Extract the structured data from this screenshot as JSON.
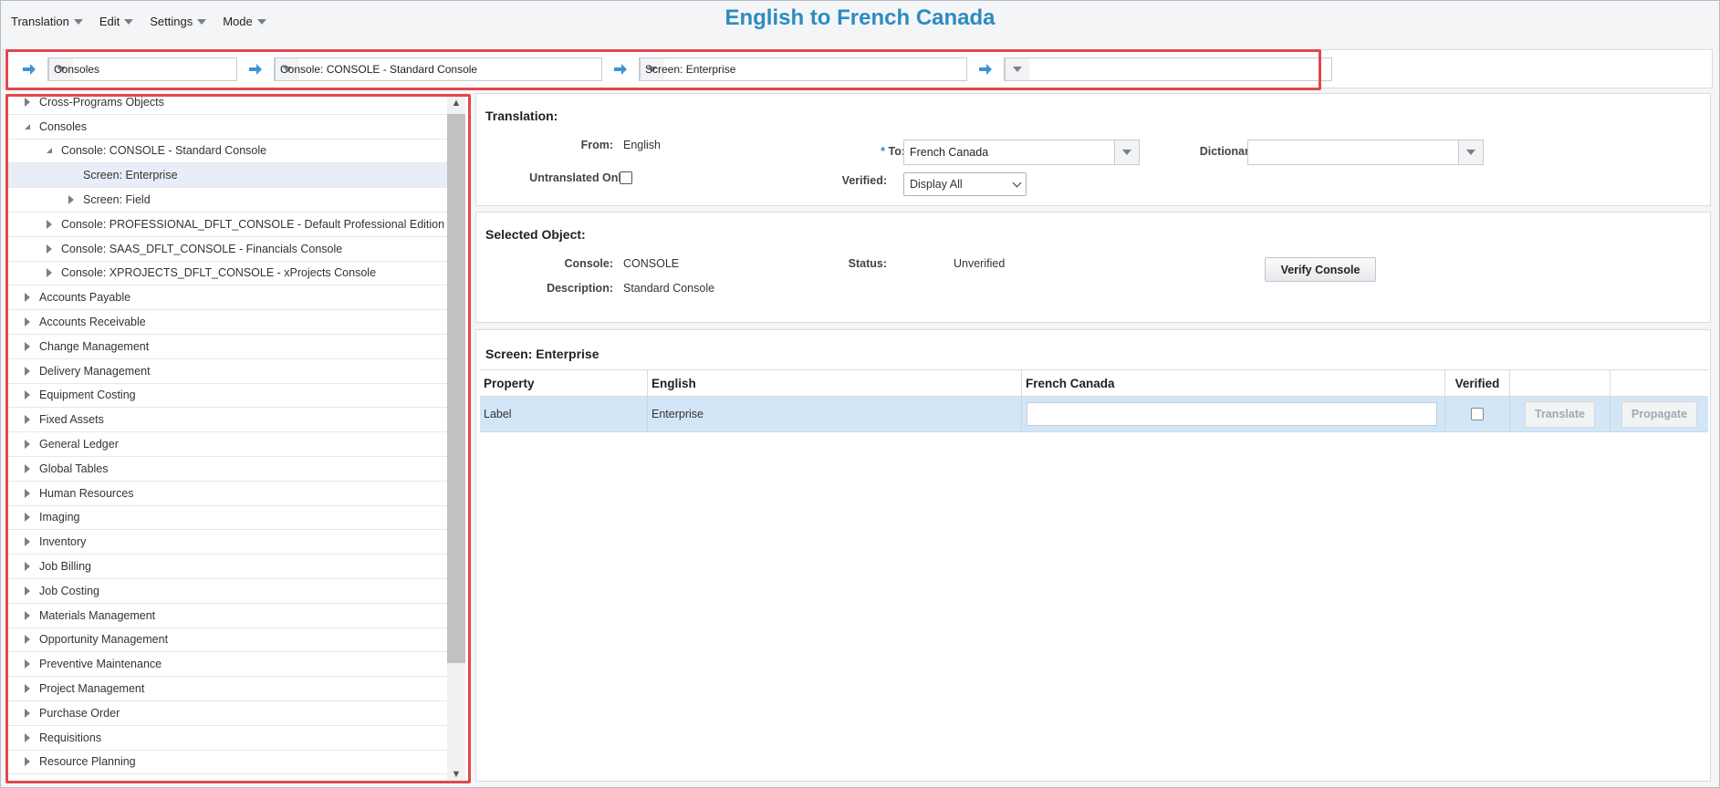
{
  "menu": {
    "items": [
      {
        "label": "Translation"
      },
      {
        "label": "Edit"
      },
      {
        "label": "Settings"
      },
      {
        "label": "Mode"
      }
    ]
  },
  "title": "English to French Canada",
  "breadcrumb": {
    "items": [
      {
        "value": "Consoles"
      },
      {
        "value": "Console: CONSOLE - Standard Console"
      },
      {
        "value": "Screen: Enterprise"
      },
      {
        "value": ""
      }
    ]
  },
  "tree": {
    "items": [
      {
        "label": "Cross-Programs Objects",
        "level": 0,
        "state": "collapsed"
      },
      {
        "label": "Consoles",
        "level": 0,
        "state": "expanded"
      },
      {
        "label": "Console: CONSOLE - Standard Console",
        "level": 1,
        "state": "expanded"
      },
      {
        "label": "Screen: Enterprise",
        "level": 2,
        "state": "leaf",
        "selected": true
      },
      {
        "label": "Screen: Field",
        "level": 2,
        "state": "collapsed"
      },
      {
        "label": "Console: PROFESSIONAL_DFLT_CONSOLE - Default Professional Edition Cc",
        "level": 1,
        "state": "collapsed"
      },
      {
        "label": "Console: SAAS_DFLT_CONSOLE - Financials Console",
        "level": 1,
        "state": "collapsed"
      },
      {
        "label": "Console: XPROJECTS_DFLT_CONSOLE - xProjects Console",
        "level": 1,
        "state": "collapsed"
      },
      {
        "label": "Accounts Payable",
        "level": 0,
        "state": "collapsed"
      },
      {
        "label": "Accounts Receivable",
        "level": 0,
        "state": "collapsed"
      },
      {
        "label": "Change Management",
        "level": 0,
        "state": "collapsed"
      },
      {
        "label": "Delivery Management",
        "level": 0,
        "state": "collapsed"
      },
      {
        "label": "Equipment Costing",
        "level": 0,
        "state": "collapsed"
      },
      {
        "label": "Fixed Assets",
        "level": 0,
        "state": "collapsed"
      },
      {
        "label": "General Ledger",
        "level": 0,
        "state": "collapsed"
      },
      {
        "label": "Global Tables",
        "level": 0,
        "state": "collapsed"
      },
      {
        "label": "Human Resources",
        "level": 0,
        "state": "collapsed"
      },
      {
        "label": "Imaging",
        "level": 0,
        "state": "collapsed"
      },
      {
        "label": "Inventory",
        "level": 0,
        "state": "collapsed"
      },
      {
        "label": "Job Billing",
        "level": 0,
        "state": "collapsed"
      },
      {
        "label": "Job Costing",
        "level": 0,
        "state": "collapsed"
      },
      {
        "label": "Materials Management",
        "level": 0,
        "state": "collapsed"
      },
      {
        "label": "Opportunity Management",
        "level": 0,
        "state": "collapsed"
      },
      {
        "label": "Preventive Maintenance",
        "level": 0,
        "state": "collapsed"
      },
      {
        "label": "Project Management",
        "level": 0,
        "state": "collapsed"
      },
      {
        "label": "Purchase Order",
        "level": 0,
        "state": "collapsed"
      },
      {
        "label": "Requisitions",
        "level": 0,
        "state": "collapsed"
      },
      {
        "label": "Resource Planning",
        "level": 0,
        "state": "collapsed"
      }
    ]
  },
  "translation": {
    "heading": "Translation:",
    "from_label": "From:",
    "from_value": "English",
    "to_required": "*",
    "to_label": "To:",
    "to_value": "French Canada",
    "dictionary_label": "Dictionary:",
    "dictionary_value": "",
    "untranslated_label": "Untranslated Only:",
    "verified_label": "Verified:",
    "verified_value": "Display All"
  },
  "selected_object": {
    "heading": "Selected Object:",
    "console_label": "Console:",
    "console_value": "CONSOLE",
    "status_label": "Status:",
    "status_value": "Unverified",
    "description_label": "Description:",
    "description_value": "Standard Console",
    "verify_button": "Verify Console"
  },
  "screen": {
    "heading": "Screen: Enterprise",
    "columns": [
      "Property",
      "English",
      "French Canada",
      "Verified",
      "",
      ""
    ],
    "rows": [
      {
        "property": "Label",
        "english": "Enterprise",
        "french": "",
        "verified": false,
        "translate": "Translate",
        "propagate": "Propagate"
      }
    ]
  },
  "colors": {
    "accent": "#2c8bc1",
    "highlight_border": "#e0484c",
    "selected_row": "#d3e6f8"
  }
}
